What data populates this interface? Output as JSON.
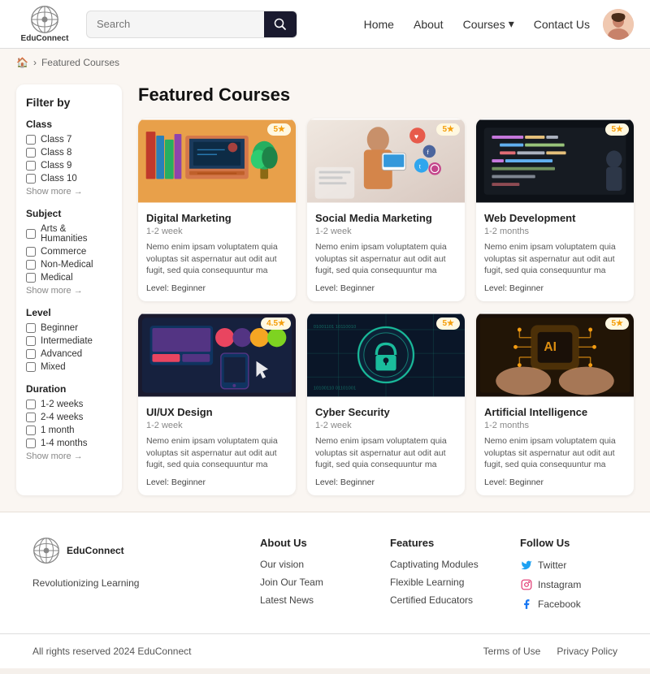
{
  "header": {
    "logo_text": "EduConnect",
    "search_placeholder": "Search",
    "nav_home": "Home",
    "nav_about": "About",
    "nav_courses": "Courses",
    "nav_courses_arrow": "▾",
    "nav_contact": "Contact Us"
  },
  "breadcrumb": {
    "home_icon": "🏠",
    "separator": "›",
    "current": "Featured Courses"
  },
  "sidebar": {
    "title": "Filter by",
    "groups": [
      {
        "label": "Class",
        "items": [
          "Class 7",
          "Class 8",
          "Class 9",
          "Class 10"
        ],
        "show_more": "Show more →"
      },
      {
        "label": "Subject",
        "items": [
          "Arts & Humanities",
          "Commerce",
          "Non-Medical",
          "Medical"
        ],
        "show_more": "Show more →"
      },
      {
        "label": "Level",
        "items": [
          "Beginner",
          "Intermediate",
          "Advanced",
          "Mixed"
        ]
      },
      {
        "label": "Duration",
        "items": [
          "1-2 weeks",
          "2-4 weeks",
          "1 month",
          "1-4 months"
        ],
        "show_more": "Show more →"
      }
    ]
  },
  "main": {
    "page_title": "Featured Courses"
  },
  "courses": [
    {
      "name": "Digital Marketing",
      "duration": "1-2 week",
      "desc": "Nemo enim ipsam voluptatem quia voluptas sit aspernatur aut odit aut fugit, sed quia consequuntur ma",
      "level": "Level: Beginner",
      "rating": "5★",
      "color1": "#e8a87c",
      "color2": "#c0392b"
    },
    {
      "name": "Social Media Marketing",
      "duration": "1-2 week",
      "desc": "Nemo enim ipsam voluptatem quia voluptas sit aspernatur aut odit aut fugit, sed quia consequuntur ma",
      "level": "Level: Beginner",
      "rating": "5★",
      "color1": "#bdc3c7",
      "color2": "#95a5a6"
    },
    {
      "name": "Web Development",
      "duration": "1-2 months",
      "desc": "Nemo enim ipsam voluptatem quia voluptas sit aspernatur aut odit aut fugit, sed quia consequuntur ma",
      "level": "Level: Beginner",
      "rating": "5★",
      "color1": "#1a1a2e",
      "color2": "#16213e"
    },
    {
      "name": "UI/UX Design",
      "duration": "1-2 week",
      "desc": "Nemo enim ipsam voluptatem quia voluptas sit aspernatur aut odit aut fugit, sed quia consequuntur ma",
      "level": "Level: Beginner",
      "rating": "4.5★",
      "color1": "#2c3e50",
      "color2": "#e74c3c"
    },
    {
      "name": "Cyber Security",
      "duration": "1-2 week",
      "desc": "Nemo enim ipsam voluptatem quia voluptas sit aspernatur aut odit aut fugit, sed quia consequuntur ma",
      "level": "Level: Beginner",
      "rating": "5★",
      "color1": "#1abc9c",
      "color2": "#16a085"
    },
    {
      "name": "Artificial Intelligence",
      "duration": "1-2 months",
      "desc": "Nemo enim ipsam voluptatem quia voluptas sit aspernatur aut odit aut fugit, sed quia consequuntur ma",
      "level": "Level: Beginner",
      "rating": "5★",
      "color1": "#f39c12",
      "color2": "#e67e22"
    }
  ],
  "footer": {
    "brand": "EduConnect",
    "tagline": "Revolutionizing Learning",
    "about_title": "About Us",
    "about_links": [
      "Our vision",
      "Join Our Team",
      "Latest News"
    ],
    "features_title": "Features",
    "features_links": [
      "Captivating Modules",
      "Flexible Learning",
      "Certified Educators"
    ],
    "follow_title": "Follow Us",
    "social_links": [
      {
        "label": "Twitter",
        "icon": "twitter"
      },
      {
        "label": "Instagram",
        "icon": "instagram"
      },
      {
        "label": "Facebook",
        "icon": "facebook"
      }
    ],
    "copyright": "All rights reserved 2024 EduConnect",
    "terms": "Terms of Use",
    "privacy": "Privacy Policy"
  }
}
